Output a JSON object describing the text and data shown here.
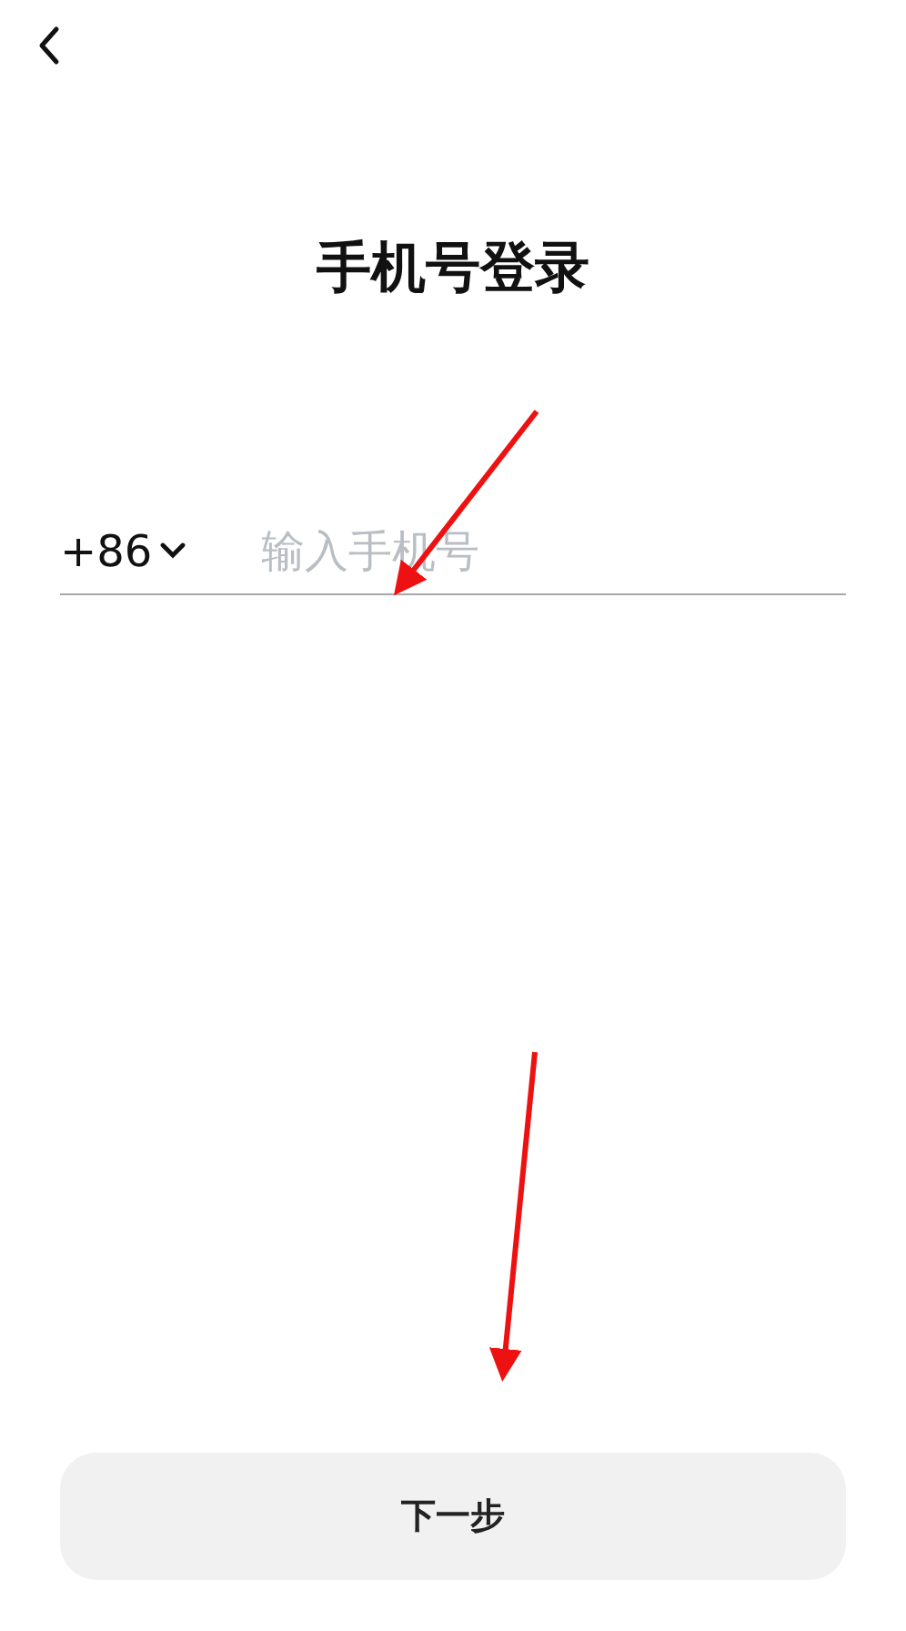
{
  "title": "手机号登录",
  "phone": {
    "country_code": "+86",
    "placeholder": "输入手机号"
  },
  "next_button": {
    "label": "下一步"
  }
}
